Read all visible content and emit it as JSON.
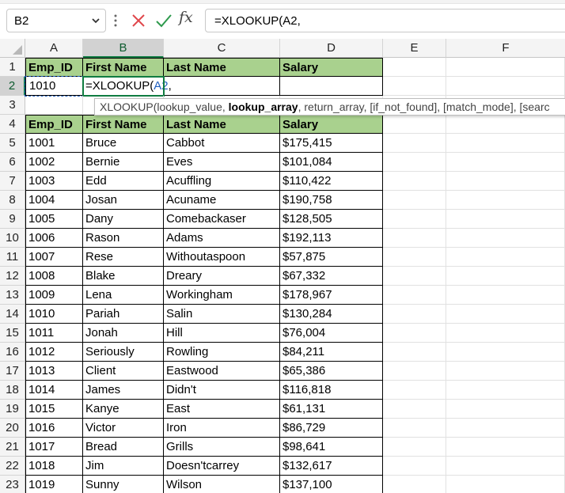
{
  "name_box": {
    "value": "B2"
  },
  "formula_bar": {
    "fx_label": "fx",
    "formula": "=XLOOKUP(A2,"
  },
  "columns": [
    "A",
    "B",
    "C",
    "D",
    "E",
    "F"
  ],
  "active_cell": {
    "col": "B",
    "row": "2"
  },
  "lookup_header": {
    "emp_id": "Emp_ID",
    "first": "First Name",
    "last": "Last Name",
    "salary": "Salary"
  },
  "lookup_input": {
    "emp_id": "1010",
    "editing_prefix": "=XLOOKUP(",
    "editing_ref": "A2",
    "editing_suffix": ","
  },
  "tooltip": {
    "func": "XLOOKUP(",
    "arg1": "lookup_value, ",
    "arg2_bold": "lookup_array",
    "rest": ", return_array, [if_not_found], [match_mode], [searc"
  },
  "table_header": {
    "emp_id": "Emp_ID",
    "first": "First Name",
    "last": "Last Name",
    "salary": "Salary"
  },
  "rows": [
    {
      "row": "5",
      "id": "1001",
      "first": "Bruce",
      "last": "Cabbot",
      "salary": "$175,415"
    },
    {
      "row": "6",
      "id": "1002",
      "first": "Bernie",
      "last": "Eves",
      "salary": "$101,084"
    },
    {
      "row": "7",
      "id": "1003",
      "first": "Edd",
      "last": "Acuffling",
      "salary": "$110,422"
    },
    {
      "row": "8",
      "id": "1004",
      "first": "Josan",
      "last": "Acuname",
      "salary": "$190,758"
    },
    {
      "row": "9",
      "id": "1005",
      "first": "Dany",
      "last": "Comebackaser",
      "salary": "$128,505"
    },
    {
      "row": "10",
      "id": "1006",
      "first": "Rason",
      "last": "Adams",
      "salary": "$192,113"
    },
    {
      "row": "11",
      "id": "1007",
      "first": "Rese",
      "last": "Withoutaspoon",
      "salary": "$57,875"
    },
    {
      "row": "12",
      "id": "1008",
      "first": "Blake",
      "last": "Dreary",
      "salary": "$67,332"
    },
    {
      "row": "13",
      "id": "1009",
      "first": "Lena",
      "last": "Workingham",
      "salary": "$178,967"
    },
    {
      "row": "14",
      "id": "1010",
      "first": "Pariah",
      "last": "Salin",
      "salary": "$130,284"
    },
    {
      "row": "15",
      "id": "1011",
      "first": "Jonah",
      "last": "Hill",
      "salary": "$76,004"
    },
    {
      "row": "16",
      "id": "1012",
      "first": "Seriously",
      "last": "Rowling",
      "salary": "$84,211"
    },
    {
      "row": "17",
      "id": "1013",
      "first": "Client",
      "last": "Eastwood",
      "salary": "$65,386"
    },
    {
      "row": "18",
      "id": "1014",
      "first": "James",
      "last": "Didn't",
      "salary": "$116,818"
    },
    {
      "row": "19",
      "id": "1015",
      "first": "Kanye",
      "last": "East",
      "salary": "$61,131"
    },
    {
      "row": "20",
      "id": "1016",
      "first": "Victor",
      "last": "Iron",
      "salary": "$86,729"
    },
    {
      "row": "21",
      "id": "1017",
      "first": "Bread",
      "last": "Grills",
      "salary": "$98,641"
    },
    {
      "row": "22",
      "id": "1018",
      "first": "Jim",
      "last": "Doesn'tcarrey",
      "salary": "$132,617"
    },
    {
      "row": "23",
      "id": "1019",
      "first": "Sunny",
      "last": "Wilson",
      "salary": "$137,100"
    }
  ],
  "row_numbers": [
    "1",
    "2",
    "3",
    "4"
  ],
  "colors": {
    "header_fill": "#a9d18e",
    "selection": "#107c41",
    "ref_blue": "#1f5fbf"
  }
}
